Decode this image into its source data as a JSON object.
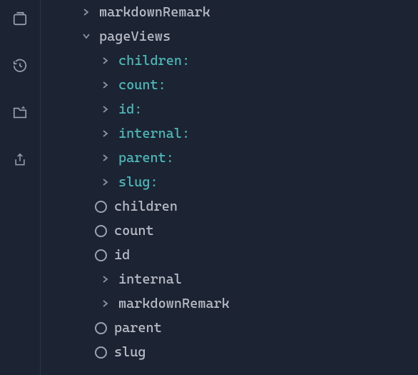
{
  "sidebar": {
    "icons": [
      "tabs",
      "history",
      "folder",
      "share"
    ]
  },
  "tree": {
    "root_items": [
      {
        "label": "markdownRemark",
        "state": "collapsed",
        "color": "gray"
      },
      {
        "label": "pageViews",
        "state": "expanded",
        "color": "gray"
      }
    ],
    "pageViews_fields": [
      {
        "label": "children",
        "kind": "arrow-teal"
      },
      {
        "label": "count",
        "kind": "arrow-teal"
      },
      {
        "label": "id",
        "kind": "arrow-teal"
      },
      {
        "label": "internal",
        "kind": "arrow-teal"
      },
      {
        "label": "parent",
        "kind": "arrow-teal"
      },
      {
        "label": "slug",
        "kind": "arrow-teal"
      },
      {
        "label": "children",
        "kind": "radio"
      },
      {
        "label": "count",
        "kind": "radio"
      },
      {
        "label": "id",
        "kind": "radio"
      },
      {
        "label": "internal",
        "kind": "arrow-gray"
      },
      {
        "label": "markdownRemark",
        "kind": "arrow-gray"
      },
      {
        "label": "parent",
        "kind": "radio"
      },
      {
        "label": "slug",
        "kind": "radio"
      }
    ]
  }
}
